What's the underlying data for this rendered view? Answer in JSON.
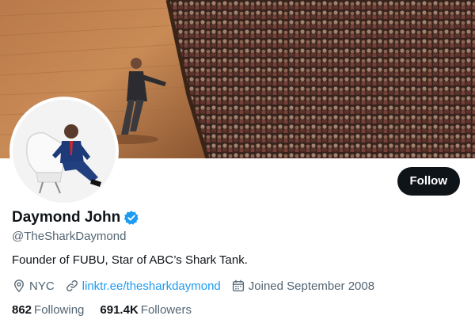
{
  "profile": {
    "display_name": "Daymond John",
    "handle": "@TheSharkDaymond",
    "bio": "Founder of FUBU, Star of ABC’s Shark Tank.",
    "location": "NYC",
    "website": "linktr.ee/thesharkdaymond",
    "joined": "Joined September 2008",
    "verified": true
  },
  "stats": {
    "following_count": "862",
    "following_label": "Following",
    "followers_count": "691.4K",
    "followers_label": "Followers"
  },
  "actions": {
    "follow_label": "Follow"
  },
  "icons": {
    "verified": "verified-badge-icon",
    "location": "location-pin-icon",
    "link": "link-icon",
    "calendar": "calendar-icon"
  },
  "colors": {
    "accent": "#1d9bf0",
    "text_primary": "#0f1419",
    "text_secondary": "#536471",
    "button_bg": "#0f1419"
  }
}
